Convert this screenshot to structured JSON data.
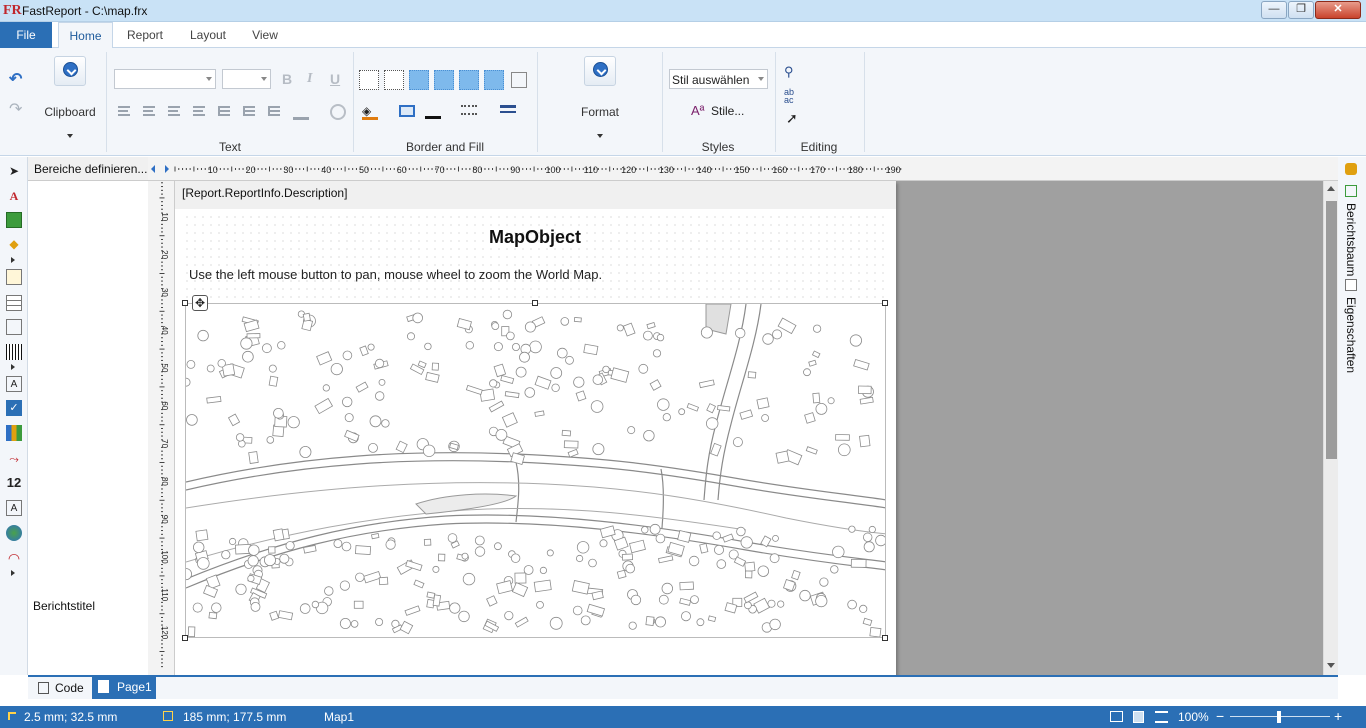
{
  "window": {
    "title": "FastReport - C:\\map.frx",
    "logo": "FR",
    "minimize": "—",
    "maximize": "❐",
    "close": "✕"
  },
  "ribbon_tabs": [
    "File",
    "Home",
    "Report",
    "Layout",
    "View"
  ],
  "ribbon": {
    "clipboard_label": "Clipboard",
    "text_label": "Text",
    "border_fill_label": "Border and Fill",
    "format_label": "Format",
    "styles_label": "Styles",
    "editing_label": "Editing",
    "style_select_value": "Stil auswählen",
    "styles_button": "Stile..."
  },
  "toolbox": {
    "items": [
      "pointer-icon",
      "text-icon",
      "picture-icon",
      "shape-icon",
      "subreport-icon",
      "table-icon",
      "matrix-icon",
      "barcode-icon",
      "richtext-icon",
      "checkbox-icon",
      "chart-icon",
      "sparkline-icon",
      "zipcode-icon",
      "cellular-text-icon",
      "map-icon",
      "gauge-icon"
    ]
  },
  "bands": {
    "header": "Bereiche definieren...",
    "report_title": "Berichtstitel"
  },
  "ruler": {
    "h_ticks": [
      "10",
      "20",
      "30",
      "40",
      "50",
      "60",
      "70",
      "80",
      "90",
      "100",
      "110",
      "120",
      "130",
      "140",
      "150",
      "160",
      "170",
      "180",
      "190"
    ],
    "v_ticks": [
      "10",
      "20",
      "30",
      "40",
      "50",
      "60",
      "70",
      "80",
      "90",
      "100",
      "110",
      "120"
    ]
  },
  "report": {
    "description": "[Report.ReportInfo.Description]",
    "title": "MapObject",
    "subtitle": "Use the left mouse button to pan, mouse wheel to zoom the World Map."
  },
  "side_tabs": [
    "Berichtsbaum",
    "Eigenschaften"
  ],
  "page_tabs": {
    "code": "Code",
    "page1": "Page1"
  },
  "status": {
    "position": "2.5 mm; 32.5 mm",
    "size": "185 mm; 177.5 mm",
    "object": "Map1",
    "zoom": "100%",
    "zoom_minus": "−",
    "zoom_plus": "+"
  }
}
